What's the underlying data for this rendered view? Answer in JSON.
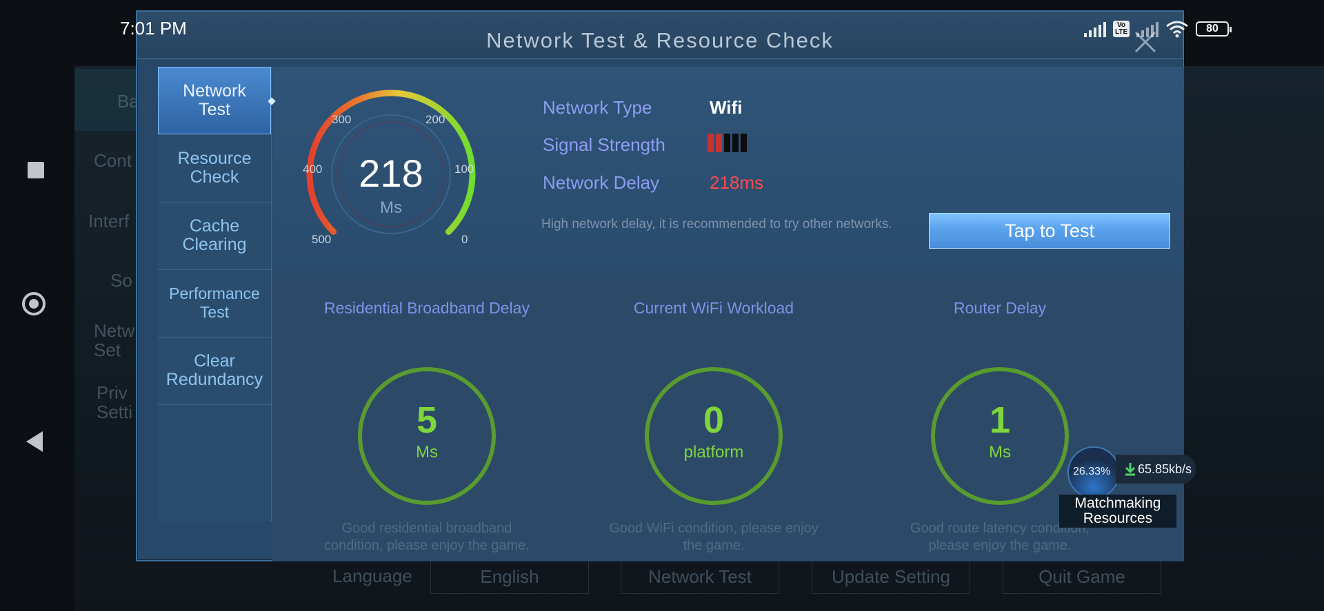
{
  "status_bar": {
    "time": "7:01 PM",
    "volte": "Vo LTE",
    "battery": "80"
  },
  "dialog": {
    "title": "Network Test & Resource Check",
    "sidebar": [
      {
        "label": "Network Test"
      },
      {
        "label": "Resource Check"
      },
      {
        "label": "Cache Clearing"
      },
      {
        "label": "Performance Test"
      },
      {
        "label": "Clear Redundancy"
      }
    ],
    "gauge": {
      "value": "218",
      "unit": "Ms",
      "ticks": [
        "500",
        "400",
        "300",
        "200",
        "100",
        "0"
      ]
    },
    "network": {
      "type_label": "Network Type",
      "type_value": "Wifi",
      "signal_label": "Signal Strength",
      "signal_level": 2,
      "signal_max": 5,
      "delay_label": "Network Delay",
      "delay_value": "218ms",
      "warning": "High network delay, it is recommended to try other networks.",
      "tap_button": "Tap to Test"
    },
    "metrics": [
      {
        "title": "Residential Broadband Delay",
        "value": "5",
        "unit": "Ms",
        "note": "Good residential broadband condition, please enjoy the game."
      },
      {
        "title": "Current WiFi Workload",
        "value": "0",
        "unit": "platform",
        "note": "Good WiFi condition, please enjoy the game."
      },
      {
        "title": "Router Delay",
        "value": "1",
        "unit": "Ms",
        "note": "Good route latency condition, please enjoy the game."
      }
    ]
  },
  "download": {
    "percent": "26.33%",
    "rate": "65.85kb/s",
    "label": "Matchmaking Resources"
  },
  "background": {
    "sidebar_labels": [
      "Ba",
      "Cont",
      "Interf",
      "So",
      "Netw Set",
      "Priv Setti"
    ],
    "bottom_label": "Language",
    "bottom_buttons": [
      "English",
      "Network Test",
      "Update Setting",
      "Quit Game"
    ]
  },
  "colors": {
    "accent": "#4a8edb",
    "good": "#7fd53d",
    "bad": "#ff4a4a",
    "label": "#8d9df0"
  }
}
